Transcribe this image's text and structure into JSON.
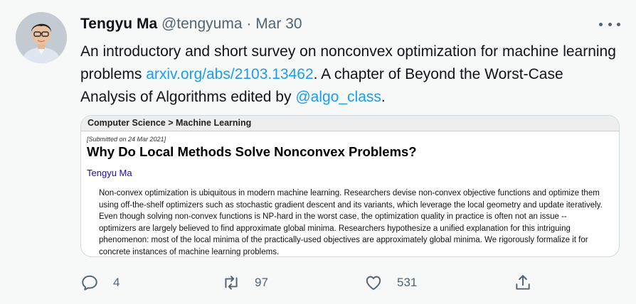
{
  "tweet": {
    "author_name": "Tengyu Ma",
    "handle": "@tengyuma",
    "separator": " · ",
    "date": "Mar 30",
    "text_part1": "An introductory and short survey on nonconvex optimization for machine learning problems ",
    "link": "arxiv.org/abs/2103.13462",
    "text_part2": ". A chapter of Beyond the Worst-Case Analysis of Algorithms edited by ",
    "mention": "@algo_class",
    "text_part3": "."
  },
  "card": {
    "breadcrumb": "Computer Science > Machine Learning",
    "submitted": "[Submitted on 24 Mar 2021]",
    "title": "Why Do Local Methods Solve Nonconvex Problems?",
    "author": "Tengyu Ma",
    "abstract": "Non-convex optimization is ubiquitous in modern machine learning. Researchers devise non-convex objective functions and optimize them using off-the-shelf optimizers such as stochastic gradient descent and its variants, which leverage the local geometry and update iteratively. Even though solving non-convex functions is NP-hard in the worst case, the optimization quality in practice is often not an issue -- optimizers are largely believed to find approximate global minima. Researchers hypothesize a unified explanation for this intriguing phenomenon: most of the local minima of the practically-used objectives are approximately global minima. We rigorously formalize it for concrete instances of machine learning problems."
  },
  "actions": {
    "reply_count": "4",
    "retweet_count": "97",
    "like_count": "531"
  },
  "icons": {
    "more": "more-icon",
    "reply": "reply-icon",
    "retweet": "retweet-icon",
    "like": "like-icon",
    "share": "share-icon"
  },
  "colors": {
    "background": "#f7f9f9",
    "link": "#1d9bf0",
    "muted": "#536471",
    "arxiv_author": "#1a0dab"
  }
}
